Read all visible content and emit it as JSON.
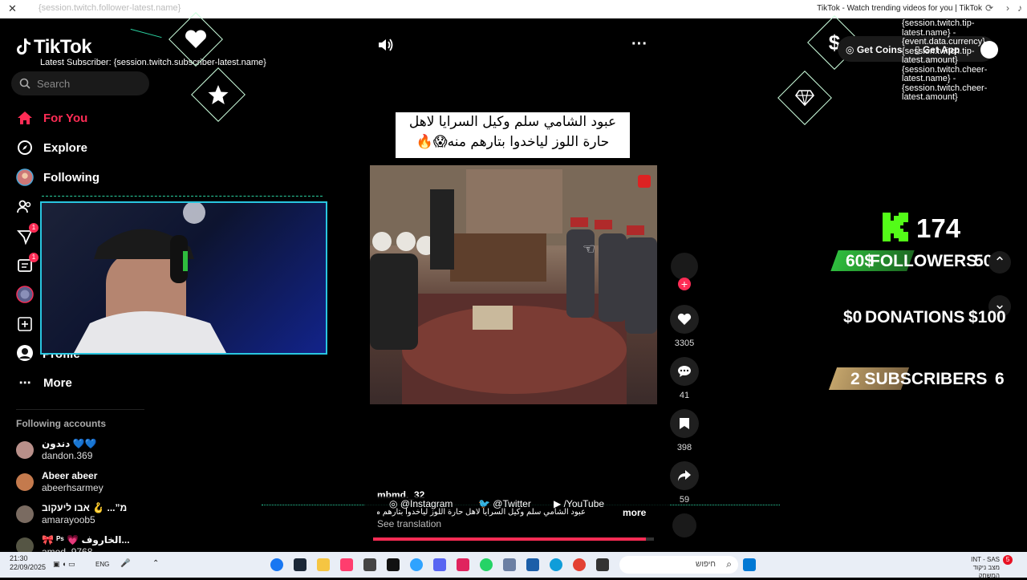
{
  "browser": {
    "window_title": "TikTok - Watch trending videos for you | TikTok",
    "ghost_text": "{session.twitch.follower-latest.name}"
  },
  "sidebar": {
    "logo": "TikTok",
    "search_placeholder": "Search",
    "nav": [
      {
        "label": "For You",
        "icon": "home-icon"
      },
      {
        "label": "Explore",
        "icon": "compass-icon"
      },
      {
        "label": "Following",
        "icon": "following-avatar"
      }
    ],
    "hidden_nav_label": "Profile",
    "more_label": "More",
    "badges": {
      "messages": "1",
      "inbox": "1"
    },
    "following_accounts_title": "Following accounts",
    "accounts": [
      {
        "name": "دندون 💙💙",
        "handle": "dandon.369"
      },
      {
        "name": "Abeer abeer",
        "handle": "abeerhsarmey"
      },
      {
        "name": "מ”... 🪝 אבו ליעקוב",
        "handle": "amarayoob5"
      },
      {
        "name": "🎀 ᴾˢ 💗 الخاروف...",
        "handle": "amed_9768"
      }
    ]
  },
  "overlay": {
    "latest_subscriber": "Latest Subscriber: {session.twitch.subscriber-latest.name}",
    "tip_lines": [
      "{session.twitch.tip-",
      "latest.name} -",
      "{event.data.currency}",
      "{session.twitch.tip-",
      "latest.amount}",
      "{session.twitch.cheer-",
      "latest.name} -",
      "{session.twitch.cheer-",
      "latest.amount}"
    ],
    "get_coins": "Get Coins",
    "get_app": "Get App",
    "followers_count": "174",
    "followers_left": "60$",
    "followers_label": "FOLLOWERS",
    "followers_right": "50K",
    "donations_left": "$0",
    "donations_label": "DONATIONS",
    "donations_right": "$100",
    "subscribers_label": "2 SUBSCRIBERS",
    "subscribers_right": "6",
    "social": {
      "instagram": "@Instagram",
      "twitter": "@Twitter",
      "youtube": "/YouTube"
    }
  },
  "video": {
    "caption_line1": "عبود الشامي سلم وكيل السرايا لاهل",
    "caption_line2": "حارة اللوز لياخدوا بتارهم منه😱🔥",
    "author": "mbmd._32",
    "description": "عبود الشامي سلم وكيل السرايا لاهل حارة اللوز لياخدوا بتارهم منه 😱 🔥 ...",
    "more_label": "more",
    "see_translation": "See translation",
    "progress": 0.97,
    "likes": "3305",
    "comments": "41",
    "saves": "398",
    "shares": "59"
  },
  "taskbar": {
    "time": "21:30",
    "date": "22/09/2025",
    "lang": "ENG",
    "search_text": "חיפוש",
    "tray_lang": "INT - SAS",
    "tray_text": "מצב ניקוד המשחק",
    "notif_count": "5"
  },
  "colors": {
    "accent": "#fe2c55",
    "webcam_border": "#29c6e0",
    "green": "#2fbd3e",
    "gold": "#c3a46b"
  }
}
